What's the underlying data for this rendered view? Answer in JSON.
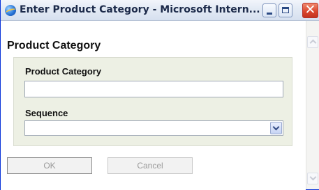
{
  "window": {
    "title": "Enter Product Category - Microsoft Intern...",
    "icon": "internet-explorer-icon"
  },
  "form": {
    "heading": "Product Category",
    "category_label": "Product Category",
    "category_value": "",
    "sequence_label": "Sequence",
    "sequence_value": ""
  },
  "buttons": {
    "ok_label": "OK",
    "cancel_label": "Cancel"
  },
  "colors": {
    "panel_background": "#edf0e4",
    "title_text": "#1c2a4a",
    "close_button": "#d9442c"
  }
}
